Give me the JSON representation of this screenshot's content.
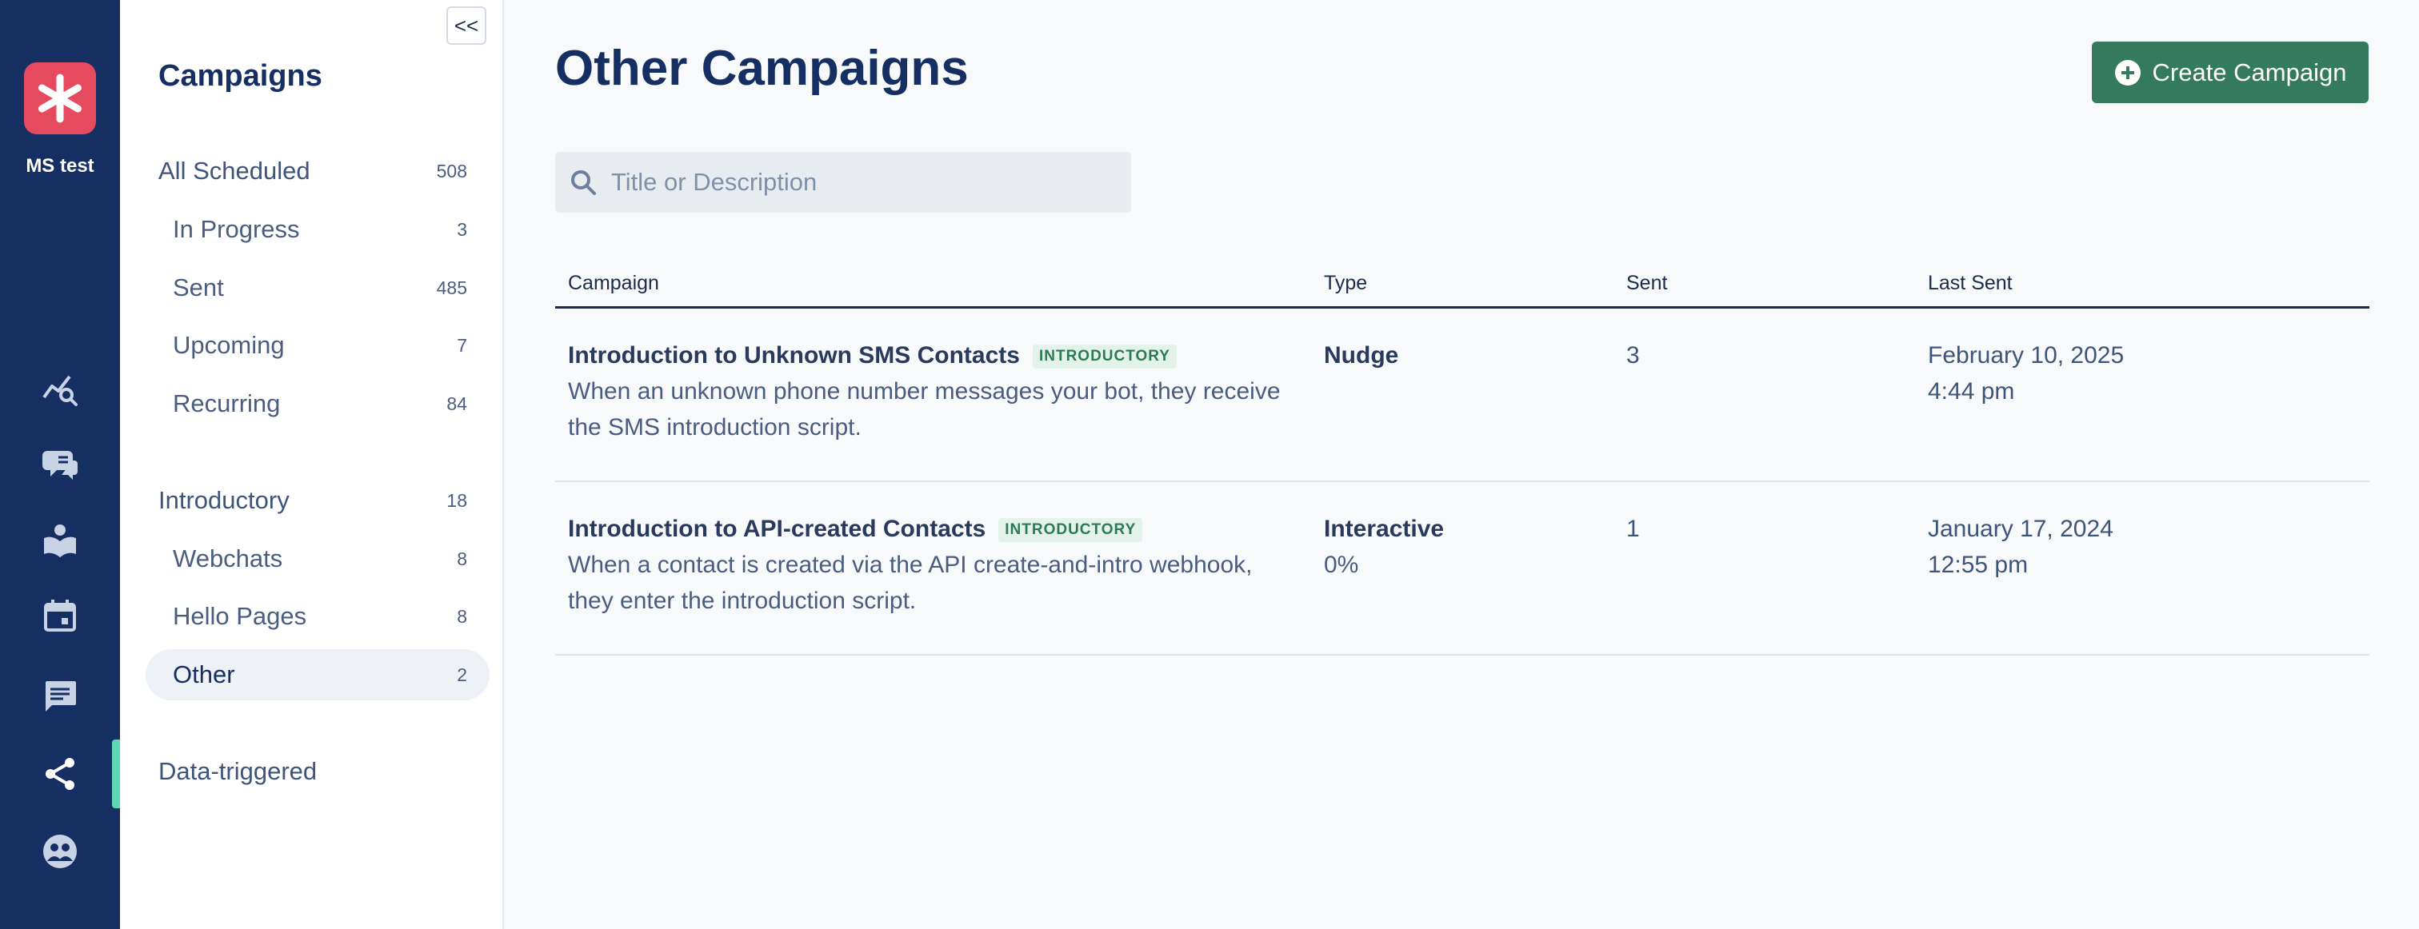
{
  "org": {
    "name": "MS test"
  },
  "sidebar": {
    "collapse_label": "<<",
    "title": "Campaigns",
    "items": [
      {
        "label": "All Scheduled",
        "count": "508"
      },
      {
        "label": "In Progress",
        "count": "3"
      },
      {
        "label": "Sent",
        "count": "485"
      },
      {
        "label": "Upcoming",
        "count": "7"
      },
      {
        "label": "Recurring",
        "count": "84"
      },
      {
        "label": "Introductory",
        "count": "18"
      },
      {
        "label": "Webchats",
        "count": "8"
      },
      {
        "label": "Hello Pages",
        "count": "8"
      },
      {
        "label": "Other",
        "count": "2"
      },
      {
        "label": "Data-triggered"
      }
    ]
  },
  "rail": {
    "icons": [
      "analytics-icon",
      "chat-bubbles-icon",
      "knowledge-book-icon",
      "calendar-icon",
      "messages-icon",
      "campaigns-share-icon",
      "contacts-icon"
    ]
  },
  "main": {
    "title": "Other Campaigns",
    "create_label": "Create Campaign",
    "search_placeholder": "Title or Description",
    "columns": [
      "Campaign",
      "Type",
      "Sent",
      "Last Sent"
    ],
    "rows": [
      {
        "title": "Introduction to Unknown SMS Contacts",
        "badge": "INTRODUCTORY",
        "description": "When an unknown phone number messages your bot, they receive the SMS introduction script.",
        "type": "Nudge",
        "type_detail": "",
        "sent": "3",
        "last_date": "February 10, 2025",
        "last_time": "4:44 pm"
      },
      {
        "title": "Introduction to API-created Contacts",
        "badge": "INTRODUCTORY",
        "description": "When a contact is created via the API create-and-intro webhook, they enter the introduction script.",
        "type": "Interactive",
        "type_detail": "0%",
        "sent": "1",
        "last_date": "January 17, 2024",
        "last_time": "12:55 pm"
      }
    ]
  },
  "colors": {
    "rail": "#152f63",
    "accent": "#347a5e",
    "logo": "#e64a5f",
    "active_marker": "#5fd6b3"
  }
}
